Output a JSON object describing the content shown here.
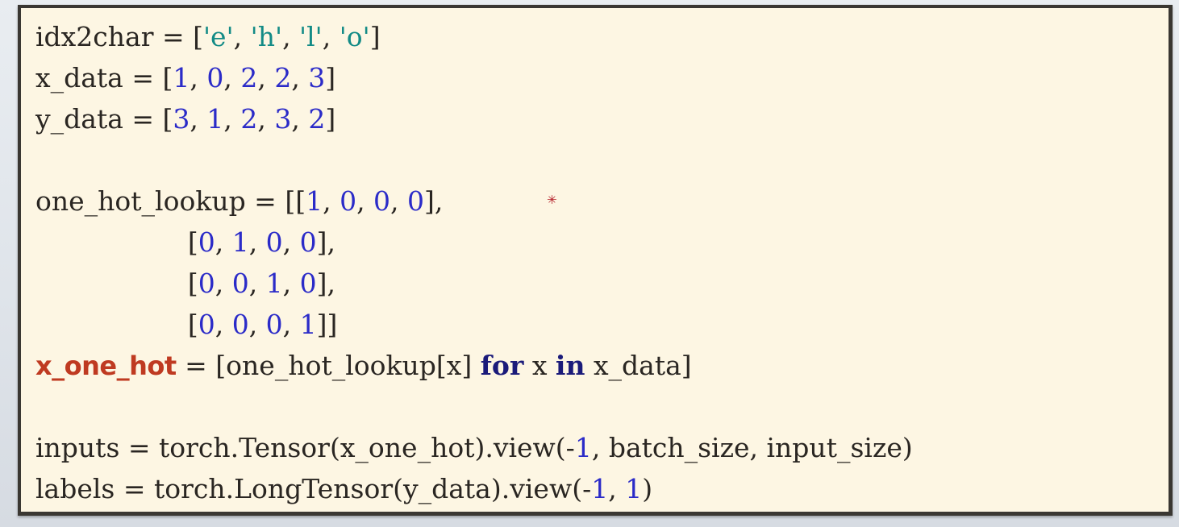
{
  "slide": {
    "background_color": "#e3e7ec",
    "panel_background_color": "#fdf6e3",
    "panel_border_color": "#3a3732"
  },
  "theme": {
    "text_color": "#2a2622",
    "number_color": "#2b2bc8",
    "string_color": "#138b86",
    "keyword_color": "#1b1b7a",
    "highlight_color": "#bf3a21",
    "cursor_mark_color": "#b4202a"
  },
  "code": {
    "language": "python",
    "lines": [
      {
        "id": "line-idx2char",
        "tokens": [
          {
            "t": "idx2char = [",
            "k": "plain"
          },
          {
            "t": "'e'",
            "k": "str"
          },
          {
            "t": ", ",
            "k": "plain"
          },
          {
            "t": "'h'",
            "k": "str"
          },
          {
            "t": ", ",
            "k": "plain"
          },
          {
            "t": "'l'",
            "k": "str"
          },
          {
            "t": ", ",
            "k": "plain"
          },
          {
            "t": "'o'",
            "k": "str"
          },
          {
            "t": "]",
            "k": "plain"
          }
        ]
      },
      {
        "id": "line-x-data",
        "tokens": [
          {
            "t": "x_data = [",
            "k": "plain"
          },
          {
            "t": "1",
            "k": "num"
          },
          {
            "t": ", ",
            "k": "plain"
          },
          {
            "t": "0",
            "k": "num"
          },
          {
            "t": ", ",
            "k": "plain"
          },
          {
            "t": "2",
            "k": "num"
          },
          {
            "t": ", ",
            "k": "plain"
          },
          {
            "t": "2",
            "k": "num"
          },
          {
            "t": ", ",
            "k": "plain"
          },
          {
            "t": "3",
            "k": "num"
          },
          {
            "t": "]",
            "k": "plain"
          }
        ]
      },
      {
        "id": "line-y-data",
        "tokens": [
          {
            "t": "y_data = [",
            "k": "plain"
          },
          {
            "t": "3",
            "k": "num"
          },
          {
            "t": ", ",
            "k": "plain"
          },
          {
            "t": "1",
            "k": "num"
          },
          {
            "t": ", ",
            "k": "plain"
          },
          {
            "t": "2",
            "k": "num"
          },
          {
            "t": ", ",
            "k": "plain"
          },
          {
            "t": "3",
            "k": "num"
          },
          {
            "t": ", ",
            "k": "plain"
          },
          {
            "t": "2",
            "k": "num"
          },
          {
            "t": "]",
            "k": "plain"
          }
        ]
      },
      {
        "id": "line-blank-1",
        "tokens": []
      },
      {
        "id": "line-one-hot-lookup-row0",
        "tokens": [
          {
            "t": "one_hot_lookup = [[",
            "k": "plain"
          },
          {
            "t": "1",
            "k": "num"
          },
          {
            "t": ", ",
            "k": "plain"
          },
          {
            "t": "0",
            "k": "num"
          },
          {
            "t": ", ",
            "k": "plain"
          },
          {
            "t": "0",
            "k": "num"
          },
          {
            "t": ", ",
            "k": "plain"
          },
          {
            "t": "0",
            "k": "num"
          },
          {
            "t": "],",
            "k": "plain"
          }
        ]
      },
      {
        "id": "line-one-hot-lookup-row1",
        "tokens": [
          {
            "t": "                  [",
            "k": "plain"
          },
          {
            "t": "0",
            "k": "num"
          },
          {
            "t": ", ",
            "k": "plain"
          },
          {
            "t": "1",
            "k": "num"
          },
          {
            "t": ", ",
            "k": "plain"
          },
          {
            "t": "0",
            "k": "num"
          },
          {
            "t": ", ",
            "k": "plain"
          },
          {
            "t": "0",
            "k": "num"
          },
          {
            "t": "],",
            "k": "plain"
          }
        ]
      },
      {
        "id": "line-one-hot-lookup-row2",
        "tokens": [
          {
            "t": "                  [",
            "k": "plain"
          },
          {
            "t": "0",
            "k": "num"
          },
          {
            "t": ", ",
            "k": "plain"
          },
          {
            "t": "0",
            "k": "num"
          },
          {
            "t": ", ",
            "k": "plain"
          },
          {
            "t": "1",
            "k": "num"
          },
          {
            "t": ", ",
            "k": "plain"
          },
          {
            "t": "0",
            "k": "num"
          },
          {
            "t": "],",
            "k": "plain"
          }
        ]
      },
      {
        "id": "line-one-hot-lookup-row3",
        "tokens": [
          {
            "t": "                  [",
            "k": "plain"
          },
          {
            "t": "0",
            "k": "num"
          },
          {
            "t": ", ",
            "k": "plain"
          },
          {
            "t": "0",
            "k": "num"
          },
          {
            "t": ", ",
            "k": "plain"
          },
          {
            "t": "0",
            "k": "num"
          },
          {
            "t": ", ",
            "k": "plain"
          },
          {
            "t": "1",
            "k": "num"
          },
          {
            "t": "]]",
            "k": "plain"
          }
        ]
      },
      {
        "id": "line-x-one-hot",
        "tokens": [
          {
            "t": "x_one_hot",
            "k": "hl"
          },
          {
            "t": " = [one_hot_lookup[x] ",
            "k": "plain"
          },
          {
            "t": "for",
            "k": "kw"
          },
          {
            "t": " x ",
            "k": "plain"
          },
          {
            "t": "in",
            "k": "kw"
          },
          {
            "t": " x_data]",
            "k": "plain"
          }
        ]
      },
      {
        "id": "line-blank-2",
        "tokens": []
      },
      {
        "id": "line-inputs",
        "tokens": [
          {
            "t": "inputs = torch.Tensor(x_one_hot).view(-",
            "k": "plain"
          },
          {
            "t": "1",
            "k": "num"
          },
          {
            "t": ", batch_size, input_size)",
            "k": "plain"
          }
        ]
      },
      {
        "id": "line-labels",
        "tokens": [
          {
            "t": "labels = torch.LongTensor(y_data).view(-",
            "k": "plain"
          },
          {
            "t": "1",
            "k": "num"
          },
          {
            "t": ", ",
            "k": "plain"
          },
          {
            "t": "1",
            "k": "num"
          },
          {
            "t": ")",
            "k": "plain"
          }
        ]
      }
    ]
  },
  "annotations": {
    "cursor_mark": "✳"
  }
}
